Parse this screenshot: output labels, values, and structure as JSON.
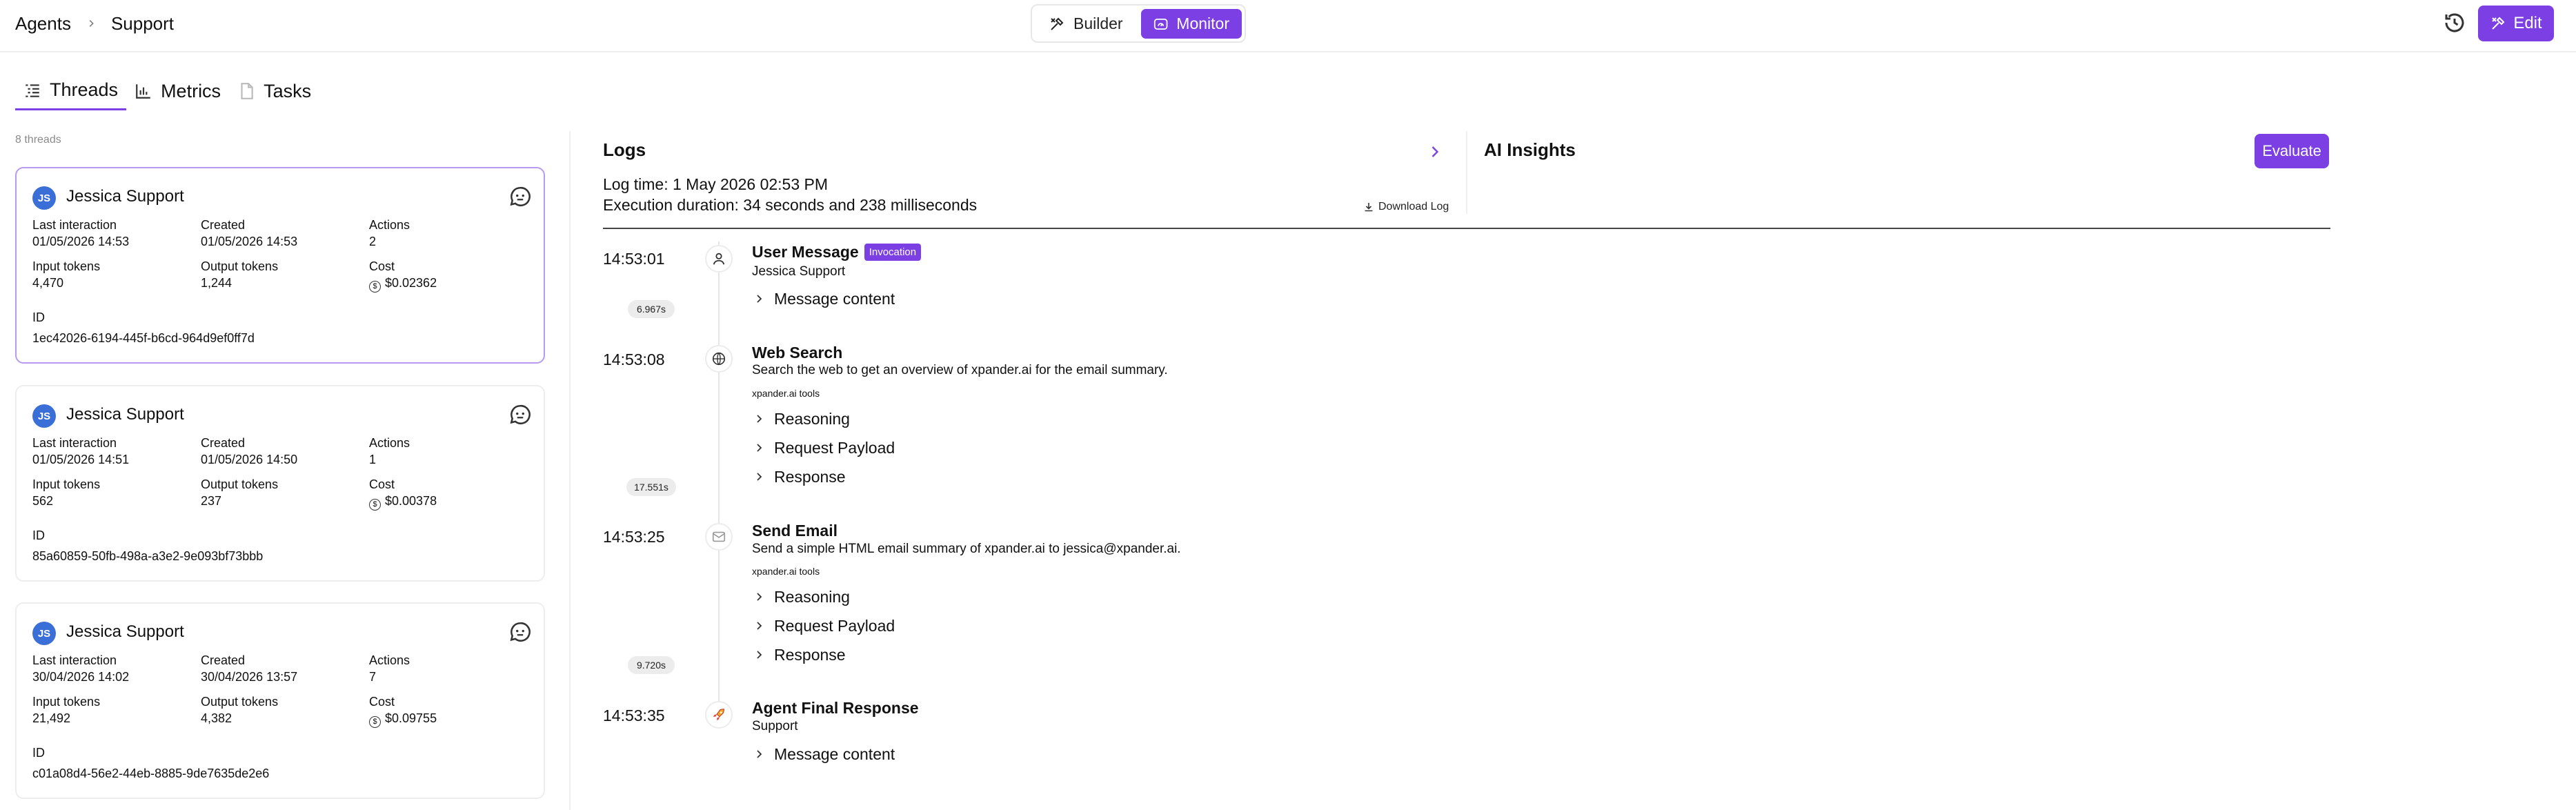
{
  "breadcrumb": {
    "root": "Agents",
    "current": "Support"
  },
  "mode_switch": {
    "builder": "Builder",
    "monitor": "Monitor"
  },
  "header": {
    "edit_label": "Edit"
  },
  "tabs": [
    {
      "label": "Threads",
      "icon": "list-icon"
    },
    {
      "label": "Metrics",
      "icon": "bar-chart-icon"
    },
    {
      "label": "Tasks",
      "icon": "document-icon"
    }
  ],
  "threads": {
    "count_label": "8 threads",
    "labels": {
      "last_interaction": "Last interaction",
      "created": "Created",
      "actions": "Actions",
      "input_tokens": "Input tokens",
      "output_tokens": "Output tokens",
      "cost": "Cost",
      "id": "ID"
    },
    "items": [
      {
        "initials": "JS",
        "name": "Jessica Support",
        "last_interaction": "01/05/2026 14:53",
        "created": "01/05/2026 14:53",
        "actions": "2",
        "input_tokens": "4,470",
        "output_tokens": "1,244",
        "cost": "$0.02362",
        "id": "1ec42026-6194-445f-b6cd-964d9ef0ff7d"
      },
      {
        "initials": "JS",
        "name": "Jessica Support",
        "last_interaction": "01/05/2026 14:51",
        "created": "01/05/2026 14:50",
        "actions": "1",
        "input_tokens": "562",
        "output_tokens": "237",
        "cost": "$0.00378",
        "id": "85a60859-50fb-498a-a3e2-9e093bf73bbb"
      },
      {
        "initials": "JS",
        "name": "Jessica Support",
        "last_interaction": "30/04/2026 14:02",
        "created": "30/04/2026 13:57",
        "actions": "7",
        "input_tokens": "21,492",
        "output_tokens": "4,382",
        "cost": "$0.09755",
        "id": "c01a08d4-56e2-44eb-8885-9de7635de2e6"
      }
    ]
  },
  "logs": {
    "title": "Logs",
    "log_time": "Log time: 1 May 2026 02:53 PM",
    "execution_duration": "Execution duration: 34 seconds and 238 milliseconds",
    "download_label": "Download Log",
    "events": [
      {
        "time": "14:53:01",
        "icon": "user-icon",
        "title": "User Message",
        "badge": "Invocation",
        "subtitle": "Jessica Support",
        "expanders": [
          "Message content"
        ]
      },
      {
        "time": "14:53:08",
        "icon": "globe-icon",
        "title": "Web Search",
        "subtitle": "Search the web to get an overview of xpander.ai for the email summary.",
        "tools": "xpander.ai tools",
        "expanders": [
          "Reasoning",
          "Request Payload",
          "Response"
        ]
      },
      {
        "time": "14:53:25",
        "icon": "mail-icon",
        "title": "Send Email",
        "subtitle": "Send a simple HTML email summary of xpander.ai to jessica@xpander.ai.",
        "tools": "xpander.ai tools",
        "expanders": [
          "Reasoning",
          "Request Payload",
          "Response"
        ]
      },
      {
        "time": "14:53:35",
        "icon": "rocket-icon",
        "title": "Agent Final Response",
        "subtitle": "Support",
        "expanders": [
          "Message content"
        ]
      }
    ],
    "durations": [
      "6.967s",
      "17.551s",
      "9.720s"
    ]
  },
  "insights": {
    "title": "AI Insights",
    "evaluate_label": "Evaluate"
  },
  "colors": {
    "accent": "#7b3fe4",
    "avatar": "#3b6fd8"
  }
}
